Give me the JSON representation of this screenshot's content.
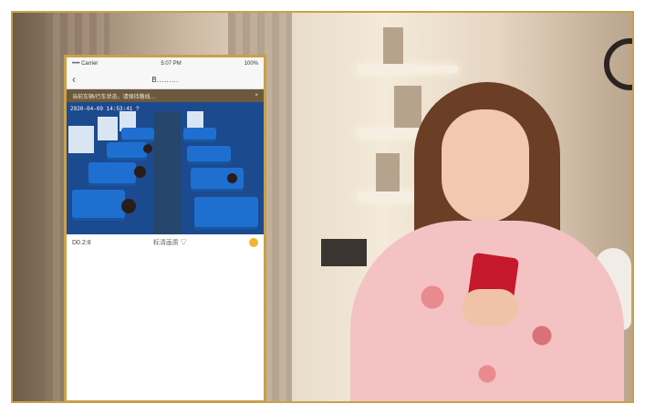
{
  "app": {
    "status": {
      "carrier": "•••• Carrier",
      "time": "5:07 PM",
      "battery": "100%"
    },
    "nav": {
      "back_icon": "chevron-left-icon",
      "title": "B………"
    },
    "banner": {
      "text": "当前车辆/行车状态，请保持路线…",
      "close_icon": "close-icon"
    },
    "video": {
      "osd": "2020-04-09 14:53:41 ?"
    },
    "controls": {
      "left_text": "D0.2:8",
      "mode_text": "标清画质 ▽",
      "action_icon": "check-circle-icon"
    }
  },
  "colors": {
    "accent_gold": "#c9a04b",
    "banner_bg": "#6b5a3e",
    "seat_blue": "#1f6fd1",
    "phone_red": "#c6182b"
  }
}
